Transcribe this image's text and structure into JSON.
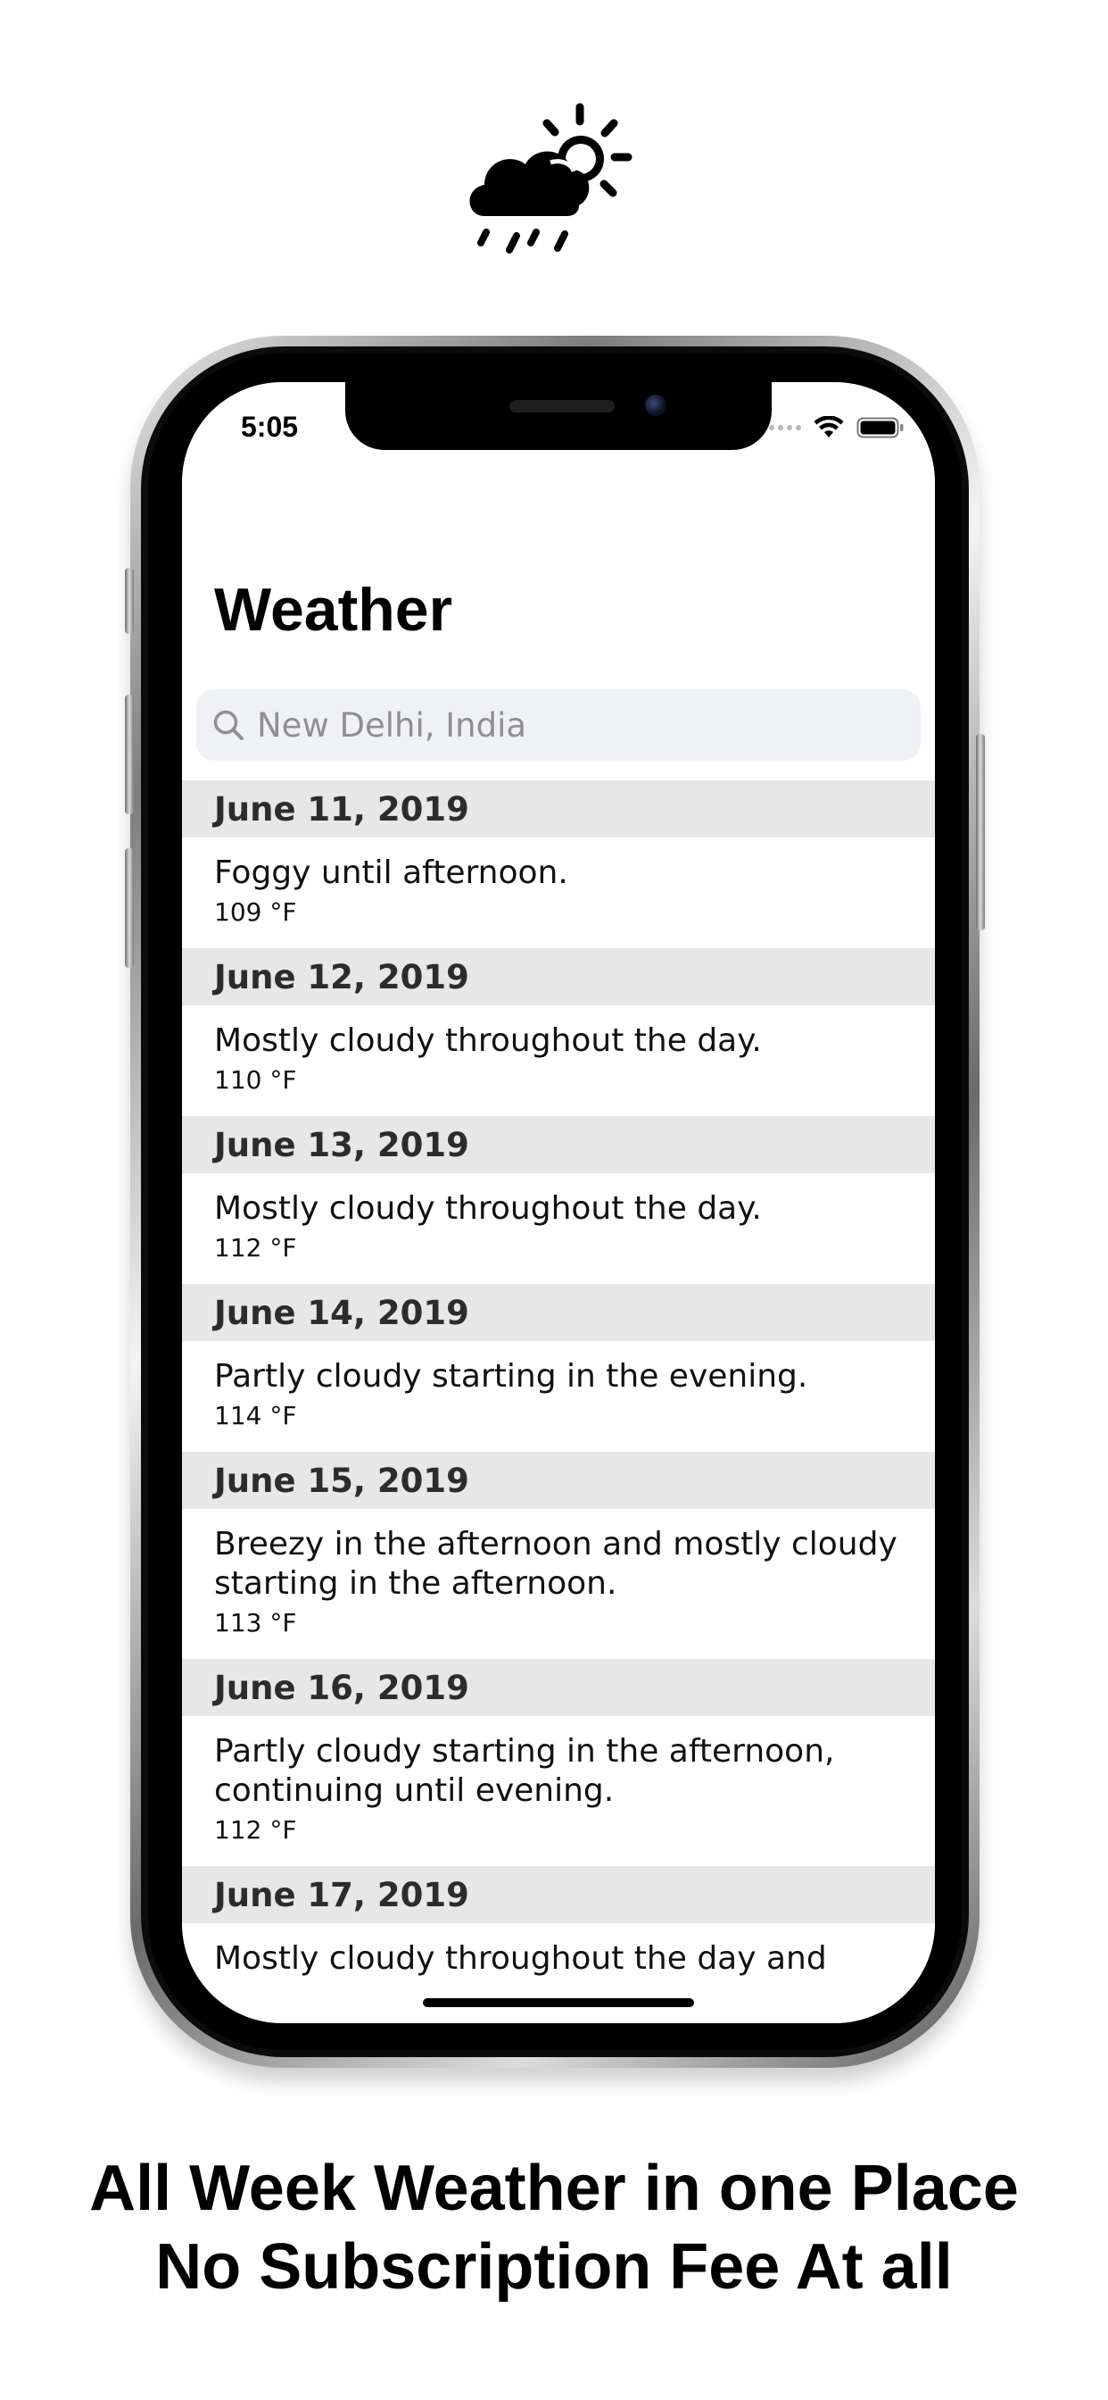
{
  "header_icon": "cloud-sun-rain-icon",
  "phone": {
    "status_bar": {
      "time": "5:05",
      "icons": [
        "signal-icon",
        "wifi-icon",
        "battery-icon"
      ]
    },
    "title": "Weather",
    "search": {
      "placeholder": "New Delhi, India",
      "value": ""
    },
    "forecast": [
      {
        "date": "June 11, 2019",
        "lines": [
          "Foggy until afternoon."
        ],
        "temp": "109 °F"
      },
      {
        "date": "June 12, 2019",
        "lines": [
          "Mostly cloudy throughout the day."
        ],
        "temp": "110 °F"
      },
      {
        "date": "June 13, 2019",
        "lines": [
          "Mostly cloudy throughout the day."
        ],
        "temp": "112 °F"
      },
      {
        "date": "June 14, 2019",
        "lines": [
          "Partly cloudy starting in the evening."
        ],
        "temp": "114 °F"
      },
      {
        "date": "June 15, 2019",
        "lines": [
          "Breezy in the afternoon and mostly cloudy",
          "starting in the afternoon."
        ],
        "temp": "113 °F"
      },
      {
        "date": "June 16, 2019",
        "lines": [
          "Partly cloudy starting in the afternoon,",
          "continuing until evening."
        ],
        "temp": "112 °F"
      },
      {
        "date": "June 17, 2019",
        "lines": [
          "Mostly cloudy throughout the day and"
        ],
        "temp": ""
      }
    ]
  },
  "caption": {
    "line1": "All Week Weather in one Place",
    "line2": "No Subscription Fee At all"
  }
}
